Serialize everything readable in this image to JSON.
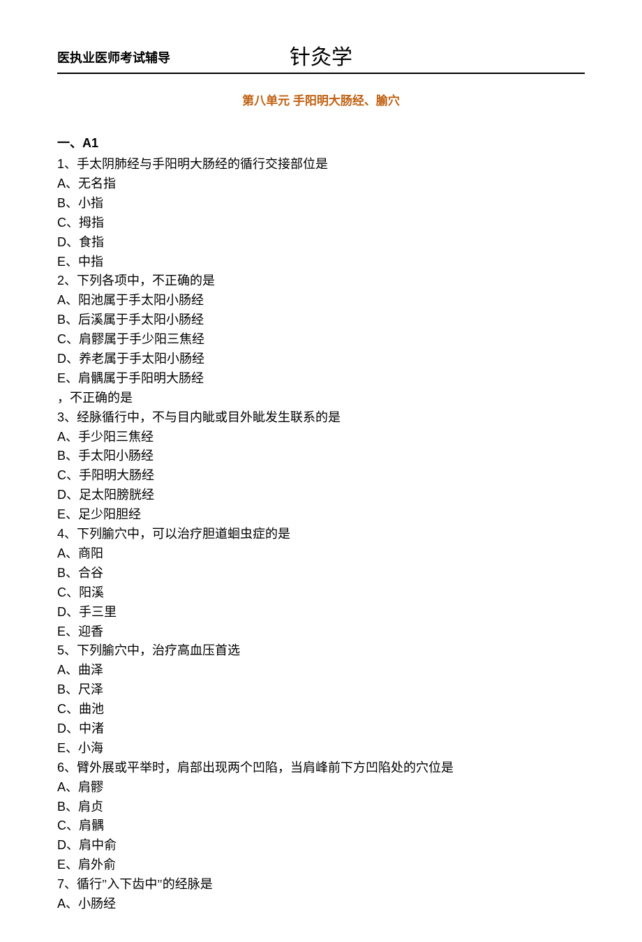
{
  "header": {
    "left": "医执业医师考试辅导",
    "center": "针灸学"
  },
  "unit_title": "第八单元 手阳明大肠经、腧穴",
  "section_label": "一、A1",
  "questions": [
    {
      "num": "1",
      "text": "、手太阴肺经与手阳明大肠经的循行交接部位是",
      "options": [
        {
          "k": "A",
          "t": "、无名指"
        },
        {
          "k": "B",
          "t": "、小指"
        },
        {
          "k": "C",
          "t": "、拇指"
        },
        {
          "k": "D",
          "t": "、食指"
        },
        {
          "k": "E",
          "t": "、中指"
        }
      ]
    },
    {
      "num": "2",
      "text": "、下列各项中，不正确的是",
      "options": [
        {
          "k": "A",
          "t": "、阳池属于手太阳小肠经"
        },
        {
          "k": "B",
          "t": "、后溪属于手太阳小肠经"
        },
        {
          "k": "C",
          "t": "、肩髎属于手少阳三焦经"
        },
        {
          "k": "D",
          "t": "、养老属于手太阳小肠经"
        },
        {
          "k": "E",
          "t": "、肩髃属于手阳明大肠经"
        }
      ],
      "extra_line": "，不正确的是"
    },
    {
      "num": "3",
      "text": "、经脉循行中，不与目内眦或目外眦发生联系的是",
      "options": [
        {
          "k": "A",
          "t": "、手少阳三焦经"
        },
        {
          "k": "B",
          "t": "、手太阳小肠经"
        },
        {
          "k": "C",
          "t": "、手阳明大肠经"
        },
        {
          "k": "D",
          "t": "、足太阳膀胱经"
        },
        {
          "k": "E",
          "t": "、足少阳胆经"
        }
      ]
    },
    {
      "num": "4",
      "text": "、下列腧穴中，可以治疗胆道蛔虫症的是",
      "options": [
        {
          "k": "A",
          "t": "、商阳"
        },
        {
          "k": "B",
          "t": "、合谷"
        },
        {
          "k": "C",
          "t": "、阳溪"
        },
        {
          "k": "D",
          "t": "、手三里"
        },
        {
          "k": "E",
          "t": "、迎香"
        }
      ]
    },
    {
      "num": "5",
      "text": "、下列腧穴中，治疗高血压首选",
      "options": [
        {
          "k": "A",
          "t": "、曲泽"
        },
        {
          "k": "B",
          "t": "、尺泽"
        },
        {
          "k": "C",
          "t": "、曲池"
        },
        {
          "k": "D",
          "t": "、中渚"
        },
        {
          "k": "E",
          "t": "、小海"
        }
      ]
    },
    {
      "num": "6",
      "text": "、臂外展或平举时，肩部出现两个凹陷，当肩峰前下方凹陷处的穴位是",
      "options": [
        {
          "k": "A",
          "t": "、肩髎"
        },
        {
          "k": "B",
          "t": "、肩贞"
        },
        {
          "k": "C",
          "t": "、肩髃"
        },
        {
          "k": "D",
          "t": "、肩中俞"
        },
        {
          "k": "E",
          "t": "、肩外俞"
        }
      ]
    },
    {
      "num": "7",
      "text": "、循行\"入下齿中\"的经脉是",
      "options": [
        {
          "k": "A",
          "t": "、小肠经"
        }
      ]
    }
  ]
}
